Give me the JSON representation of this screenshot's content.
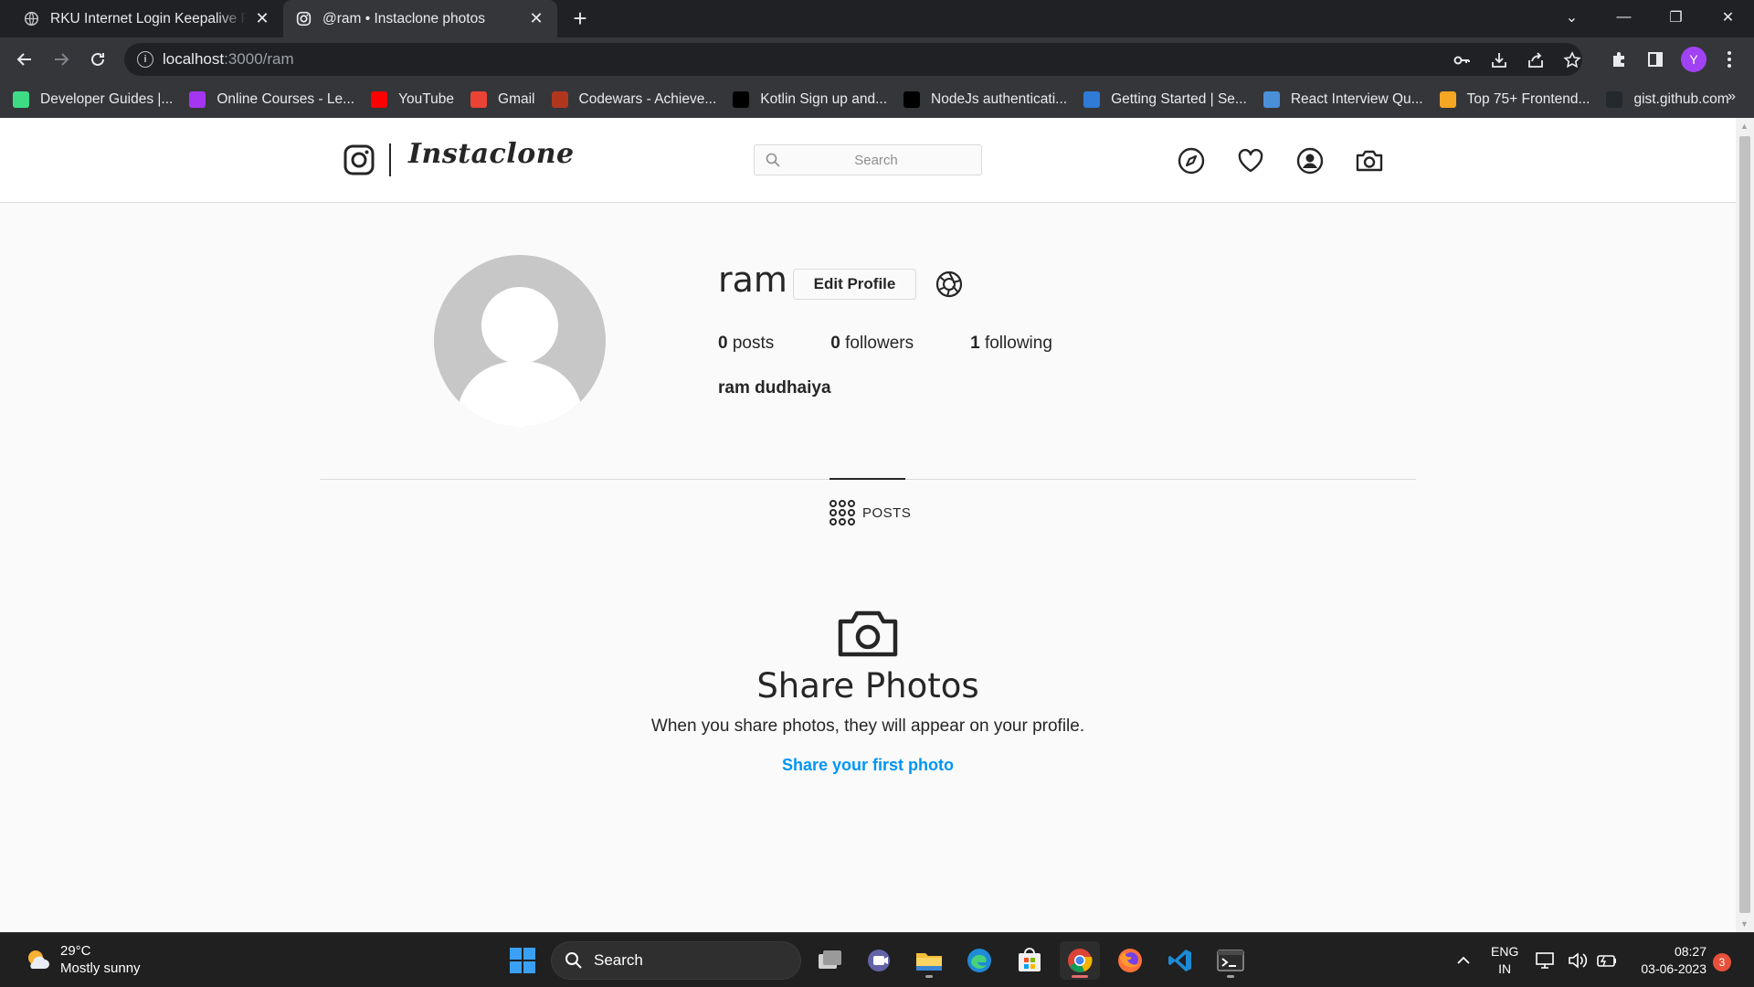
{
  "browser": {
    "tabs": [
      {
        "title": "RKU Internet Login Keepalive Page",
        "active": false
      },
      {
        "title": "@ram • Instaclone photos",
        "active": true
      }
    ],
    "url_host": "localhost",
    "url_path": ":3000/ram",
    "profile_initial": "Y",
    "bookmarks": [
      {
        "label": "Developer Guides |...",
        "icon": "android-icon",
        "color": "#3ddc84"
      },
      {
        "label": "Online Courses - Le...",
        "icon": "udemy-icon",
        "color": "#a435f0"
      },
      {
        "label": "YouTube",
        "icon": "youtube-icon",
        "color": "#ff0000"
      },
      {
        "label": "Gmail",
        "icon": "gmail-icon",
        "color": "#ea4335"
      },
      {
        "label": "Codewars - Achieve...",
        "icon": "codewars-icon",
        "color": "#b1361e"
      },
      {
        "label": "Kotlin Sign up and...",
        "icon": "medium-icon",
        "color": "#000000"
      },
      {
        "label": "NodeJs authenticati...",
        "icon": "medium-icon",
        "color": "#000000"
      },
      {
        "label": "Getting Started | Se...",
        "icon": "sequelize-icon",
        "color": "#2f7bd6"
      },
      {
        "label": "React Interview Qu...",
        "icon": "mountain-icon",
        "color": "#4a90d9"
      },
      {
        "label": "Top 75+ Frontend...",
        "icon": "flag-icon",
        "color": "#f5a623"
      },
      {
        "label": "gist.github.com",
        "icon": "github-icon",
        "color": "#24292e"
      }
    ]
  },
  "app": {
    "brand": "Instaclone",
    "search_placeholder": "Search"
  },
  "profile": {
    "username": "ram",
    "edit_label": "Edit Profile",
    "posts_count": "0",
    "posts_label": " posts",
    "followers_count": "0",
    "followers_label": " followers",
    "following_count": "1",
    "following_label": " following",
    "full_name": "ram dudhaiya"
  },
  "tabs": {
    "posts_label": "POSTS"
  },
  "empty_state": {
    "title": "Share Photos",
    "subtitle": "When you share photos, they will appear on your profile.",
    "link": "Share your first photo"
  },
  "taskbar": {
    "temperature": "29°C",
    "weather": "Mostly sunny",
    "search_label": "Search",
    "lang_line1": "ENG",
    "lang_line2": "IN",
    "time": "08:27",
    "date": "03-06-2023",
    "notification_count": "3"
  }
}
